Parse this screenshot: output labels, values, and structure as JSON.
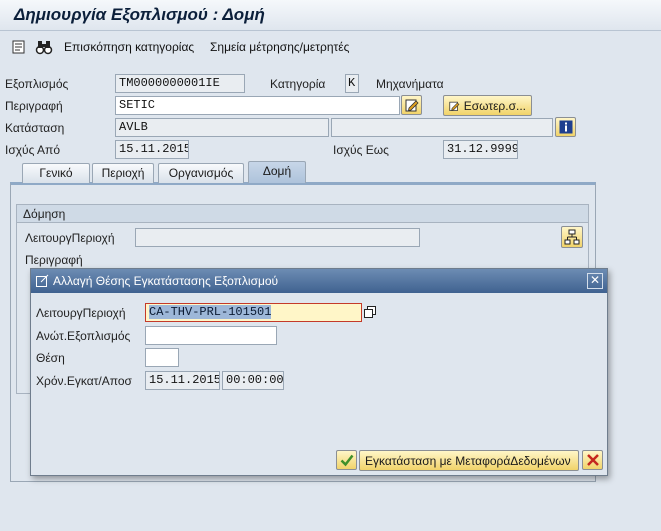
{
  "window": {
    "title": "Δημιουργία Εξοπλισμού : Δομή"
  },
  "toolbar": {
    "items": [
      {
        "icon": "details-icon"
      },
      {
        "icon": "binoculars-icon"
      },
      {
        "label": "Επισκόπηση κατηγορίας"
      },
      {
        "label": "Σημεία μέτρησης/μετρητές"
      }
    ]
  },
  "header": {
    "equipment_label": "Εξοπλισμός",
    "equipment_value": "TM0000000001IE",
    "category_label": "Κατηγορία",
    "category_value": "K",
    "category_text": "Μηχανήματα",
    "description_label": "Περιγραφή",
    "description_value": "SETIC",
    "internal_note_button": "Εσωτερ.σ...",
    "status_label": "Κατάσταση",
    "status_value": "AVLB",
    "valid_from_label": "Ισχύς Από",
    "valid_from_value": "15.11.2015",
    "valid_to_label": "Ισχύς Εως",
    "valid_to_value": "31.12.9999"
  },
  "tabs": [
    {
      "label": "Γενικό"
    },
    {
      "label": "Περιοχή"
    },
    {
      "label": "Οργανισμός"
    },
    {
      "label": "Δομή",
      "active": true
    }
  ],
  "structure": {
    "group_title": "Δόμηση",
    "functional_location_label": "ΛειτουργΠεριοχή",
    "description_label": "Περιγραφή"
  },
  "dialog": {
    "title": "Αλλαγή Θέσης Εγκατάστασης Εξοπλισμού",
    "functional_location_label": "ΛειτουργΠεριοχή",
    "functional_location_value": "CA-THV-PRL-101501",
    "superior_equipment_label": "Ανώτ.Εξοπλισμός",
    "position_label": "Θέση",
    "install_datetime_label": "Χρόν.Εγκατ/Αποσ",
    "install_date_value": "15.11.2015",
    "install_time_value": "00:00:00",
    "install_button_label": "Εγκατάσταση με ΜεταφοράΔεδομένων",
    "close_symbol": "✕"
  },
  "colors": {
    "accent_blue": "#3f6290",
    "button_yellow": "#f1d36a",
    "confirm_green": "#3f8f2a",
    "cancel_red": "#c4271f",
    "selected_text_bg": "#9db7d8"
  }
}
